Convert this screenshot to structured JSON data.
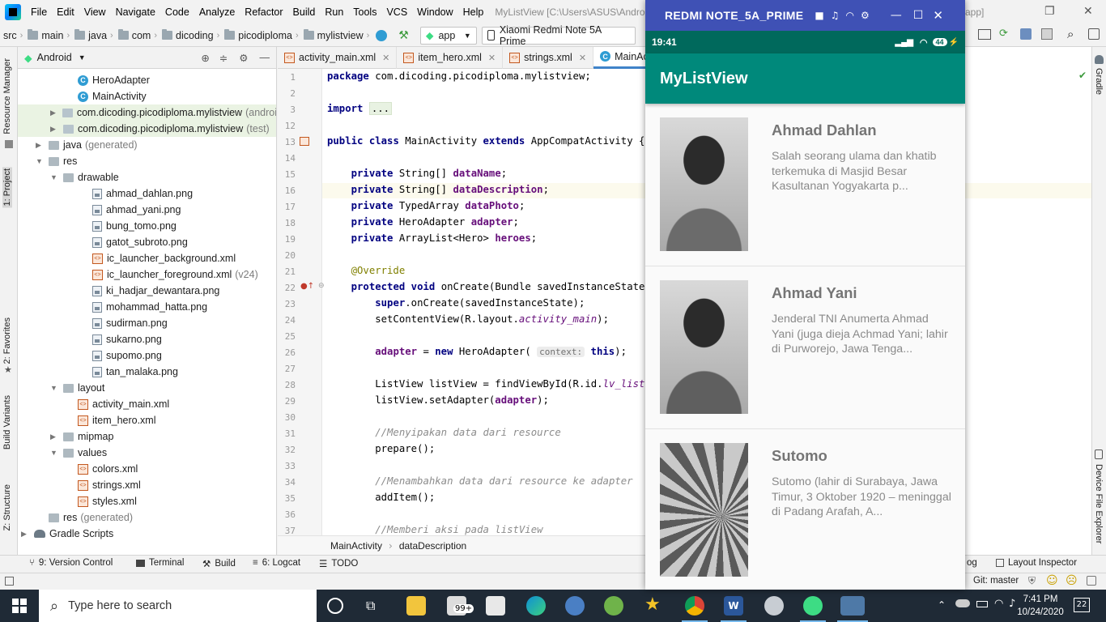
{
  "menubar": {
    "items": [
      "File",
      "Edit",
      "View",
      "Navigate",
      "Code",
      "Analyze",
      "Refactor",
      "Build",
      "Run",
      "Tools",
      "VCS",
      "Window",
      "Help"
    ],
    "window_title": "MyListView [C:\\Users\\ASUS\\AndroidStu",
    "title_tail": "app]"
  },
  "toolbar": {
    "breadcrumbs": [
      "src",
      "main",
      "java",
      "com",
      "dicoding",
      "picodiploma",
      "mylistview"
    ],
    "run_config": "app",
    "device": "Xiaomi Redmi Note 5A Prime"
  },
  "project_panel": {
    "view_selector": "Android",
    "items": [
      {
        "label": "HeroAdapter",
        "icon": "class-icon"
      },
      {
        "label": "MainActivity",
        "icon": "class-icon"
      },
      {
        "label": "com.dicoding.picodiploma.mylistview",
        "suffix": "(androi",
        "icon": "package-icon"
      },
      {
        "label": "com.dicoding.picodiploma.mylistview",
        "suffix": "(test)",
        "icon": "package-icon"
      },
      {
        "label": "java",
        "suffix": "(generated)",
        "icon": "folder-icon"
      },
      {
        "label": "res",
        "icon": "folder-icon"
      },
      {
        "label": "drawable",
        "icon": "folder-icon"
      },
      {
        "label": "ahmad_dahlan.png",
        "icon": "image-file-icon"
      },
      {
        "label": "ahmad_yani.png",
        "icon": "image-file-icon"
      },
      {
        "label": "bung_tomo.png",
        "icon": "image-file-icon"
      },
      {
        "label": "gatot_subroto.png",
        "icon": "image-file-icon"
      },
      {
        "label": "ic_launcher_background.xml",
        "icon": "xml-file-icon"
      },
      {
        "label": "ic_launcher_foreground.xml",
        "suffix": "(v24)",
        "icon": "xml-file-icon"
      },
      {
        "label": "ki_hadjar_dewantara.png",
        "icon": "image-file-icon"
      },
      {
        "label": "mohammad_hatta.png",
        "icon": "image-file-icon"
      },
      {
        "label": "sudirman.png",
        "icon": "image-file-icon"
      },
      {
        "label": "sukarno.png",
        "icon": "image-file-icon"
      },
      {
        "label": "supomo.png",
        "icon": "image-file-icon"
      },
      {
        "label": "tan_malaka.png",
        "icon": "image-file-icon"
      },
      {
        "label": "layout",
        "icon": "folder-icon"
      },
      {
        "label": "activity_main.xml",
        "icon": "xml-file-icon"
      },
      {
        "label": "item_hero.xml",
        "icon": "xml-file-icon"
      },
      {
        "label": "mipmap",
        "icon": "folder-icon"
      },
      {
        "label": "values",
        "icon": "folder-icon"
      },
      {
        "label": "colors.xml",
        "icon": "xml-file-icon"
      },
      {
        "label": "strings.xml",
        "icon": "xml-file-icon"
      },
      {
        "label": "styles.xml",
        "icon": "xml-file-icon"
      },
      {
        "label": "res",
        "suffix": "(generated)",
        "icon": "folder-icon"
      },
      {
        "label": "Gradle Scripts",
        "icon": "gradle-icon"
      }
    ]
  },
  "left_tool_windows": [
    "Resource Manager",
    "1: Project",
    "2: Favorites",
    "Build Variants",
    "Z: Structure"
  ],
  "right_tool_windows": [
    "Gradle",
    "Device File Explorer"
  ],
  "editor": {
    "tabs": [
      {
        "label": "activity_main.xml"
      },
      {
        "label": "item_hero.xml"
      },
      {
        "label": "strings.xml"
      },
      {
        "label": "MainActi"
      }
    ],
    "line_numbers": [
      "1",
      "2",
      "3",
      "12",
      "13",
      "14",
      "15",
      "16",
      "17",
      "18",
      "19",
      "20",
      "21",
      "22",
      "23",
      "24",
      "25",
      "26",
      "27",
      "28",
      "29",
      "30",
      "31",
      "32",
      "33",
      "34",
      "35",
      "36",
      "37"
    ],
    "code_lines": [
      "package com.dicoding.picodiploma.mylistview;",
      "",
      "import ...",
      "",
      "public class MainActivity extends AppCompatActivity {",
      "",
      "    private String[] dataName;",
      "    private String[] dataDescription;",
      "    private TypedArray dataPhoto;",
      "    private HeroAdapter adapter;",
      "    private ArrayList<Hero> heroes;",
      "",
      "    @Override",
      "    protected void onCreate(Bundle savedInstanceState) {",
      "        super.onCreate(savedInstanceState);",
      "        setContentView(R.layout.activity_main);",
      "",
      "        adapter = new HeroAdapter( context: this);",
      "",
      "        ListView listView = findViewById(R.id.lv_list);",
      "        listView.setAdapter(adapter);",
      "",
      "        //Menyipakan data dari resource",
      "        prepare();",
      "",
      "        //Menambahkan data dari resource ke adapter",
      "        addItem();",
      "",
      "        //Memberi aksi pada listView"
    ],
    "param_hint": "context:",
    "breadcrumb": [
      "MainActivity",
      "dataDescription"
    ]
  },
  "bottom_tools": {
    "version_control": "9: Version Control",
    "terminal": "Terminal",
    "build": "Build",
    "logcat": "6: Logcat",
    "todo": "TODO",
    "event_log": "og",
    "layout_inspector": "Layout Inspector"
  },
  "status": {
    "git_branch": "Git: master"
  },
  "phone": {
    "window_title": "REDMI NOTE_5A_PRIME",
    "time": "19:41",
    "battery": "44",
    "app_title": "MyListView",
    "heroes": [
      {
        "name": "Ahmad Dahlan",
        "description": "Salah seorang ulama dan khatib terkemuka di Masjid Besar Kasultanan Yogyakarta p..."
      },
      {
        "name": "Ahmad Yani",
        "description": "Jenderal TNI Anumerta Ahmad Yani (juga dieja Achmad Yani; lahir di Purworejo, Jawa Tenga..."
      },
      {
        "name": "Sutomo",
        "description": "Sutomo (lahir di Surabaya, Jawa Timur, 3 Oktober 1920 – meninggal di Padang Arafah, A..."
      }
    ]
  },
  "taskbar": {
    "search_placeholder": "Type here to search",
    "store_badge": "99+",
    "clock_time": "7:41 PM",
    "clock_date": "10/24/2020",
    "notifications": "22"
  },
  "colors": {
    "phone_title_bar": "#3f51b5",
    "app_bar": "#00897b",
    "status_bar": "#00695c",
    "editor_tab_accent": "#4083c9"
  }
}
